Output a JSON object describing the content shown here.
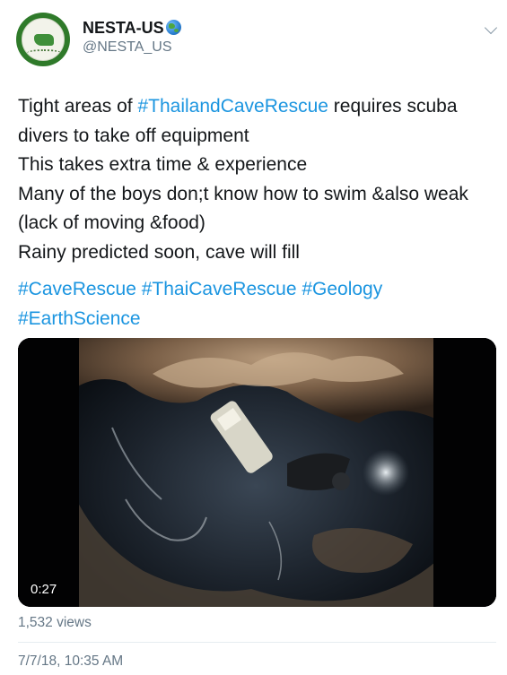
{
  "author": {
    "display_name": "NESTA-US",
    "handle": "@NESTA_US",
    "avatar_icon": "nesta-logo-icon",
    "badge_icon": "globe-emoji-icon"
  },
  "tweet": {
    "lines": [
      {
        "before": "Tight areas of ",
        "link": "#ThailandCaveRescue",
        "after": " requires scuba"
      },
      {
        "text": "divers to take off equipment"
      },
      {
        "text": "This takes extra time & experience"
      },
      {
        "text": "Many of the boys don;t know how to swim &also weak"
      },
      {
        "text": "(lack of moving &food)"
      },
      {
        "text": "Rainy predicted soon, cave will fill"
      }
    ],
    "hashtag_lines": [
      "#CaveRescue #ThaiCaveRescue #Geology",
      "#EarthScience"
    ]
  },
  "media": {
    "duration": "0:27",
    "views": "1,532 views"
  },
  "timestamp": "7/7/18, 10:35 AM",
  "colors": {
    "link": "#1b95e0",
    "secondary_text": "#657786",
    "primary_text": "#14171a"
  }
}
